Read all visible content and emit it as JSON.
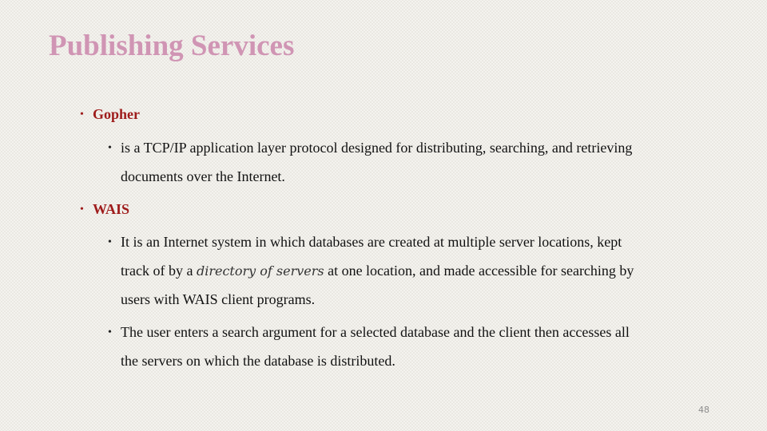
{
  "slide": {
    "title": "Publishing Services",
    "page_number": "48",
    "bullets": [
      {
        "label": "Gopher",
        "sub": [
          {
            "lines": [
              "is a TCP/IP application layer protocol designed for distributing, searching, and retrieving",
              "documents over the Internet."
            ]
          }
        ]
      },
      {
        "label": "WAIS",
        "sub": [
          {
            "line1": "It is an Internet system in which databases are created at multiple server locations, kept",
            "line2_pre": "track of by a ",
            "line2_italic": "directory of servers",
            "line2_post": " at one location, and made accessible for searching by",
            "line3": "users with WAIS client programs."
          },
          {
            "lines": [
              "The user enters a search argument for a selected database and the client then accesses all",
              "the servers on which the database is distributed."
            ]
          }
        ]
      }
    ],
    "bullet_glyph": "•"
  }
}
